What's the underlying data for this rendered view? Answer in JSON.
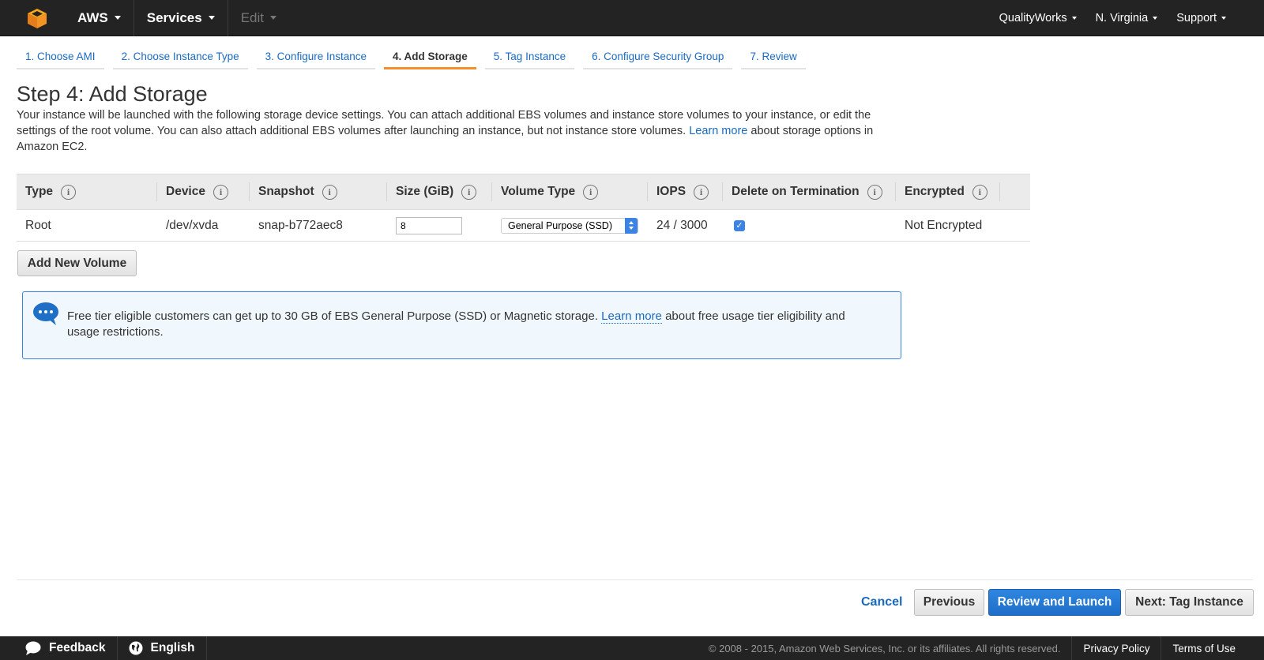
{
  "topnav": {
    "brand": "AWS",
    "services": "Services",
    "edit": "Edit",
    "account": "QualityWorks",
    "region": "N. Virginia",
    "support": "Support"
  },
  "steps": [
    {
      "label": "1. Choose AMI"
    },
    {
      "label": "2. Choose Instance Type"
    },
    {
      "label": "3. Configure Instance"
    },
    {
      "label": "4. Add Storage",
      "active": true
    },
    {
      "label": "5. Tag Instance"
    },
    {
      "label": "6. Configure Security Group"
    },
    {
      "label": "7. Review"
    }
  ],
  "page": {
    "title": "Step 4: Add Storage",
    "description_part1": "Your instance will be launched with the following storage device settings. You can attach additional EBS volumes and instance store volumes to your instance, or edit the settings of the root volume. You can also attach additional EBS volumes after launching an instance, but not instance store volumes.",
    "learn_more": "Learn more",
    "description_part2": "about storage options in Amazon EC2."
  },
  "table": {
    "headers": {
      "type": "Type",
      "device": "Device",
      "snapshot": "Snapshot",
      "size": "Size (GiB)",
      "volume_type": "Volume Type",
      "iops": "IOPS",
      "delete_on_termination": "Delete on Termination",
      "encrypted": "Encrypted"
    },
    "rows": [
      {
        "type": "Root",
        "device": "/dev/xvda",
        "snapshot": "snap-b772aec8",
        "size": "8",
        "volume_type": "General Purpose (SSD)",
        "iops": "24 / 3000",
        "delete_on_termination": true,
        "encrypted": "Not Encrypted"
      }
    ]
  },
  "add_volume_label": "Add New Volume",
  "notice": {
    "text_part1": "Free tier eligible customers can get up to 30 GB of EBS General Purpose (SSD) or Magnetic storage.",
    "learn_more": "Learn more",
    "text_part2": "about free usage tier eligibility and usage restrictions."
  },
  "actions": {
    "cancel": "Cancel",
    "previous": "Previous",
    "review_and_launch": "Review and Launch",
    "next": "Next: Tag Instance"
  },
  "footer": {
    "feedback": "Feedback",
    "language": "English",
    "copyright": "© 2008 - 2015, Amazon Web Services, Inc. or its affiliates. All rights reserved.",
    "privacy": "Privacy Policy",
    "terms": "Terms of Use"
  },
  "colors": {
    "accent": "#f28f28",
    "link": "#1a6ac0",
    "primary_button": "#2f86e0",
    "topbar": "#232323"
  },
  "icons": {
    "logo": "aws-cube-icon",
    "info": "info-icon",
    "notice": "chat-bubble-icon",
    "feedback": "speech-bubble-icon",
    "language": "globe-icon"
  }
}
